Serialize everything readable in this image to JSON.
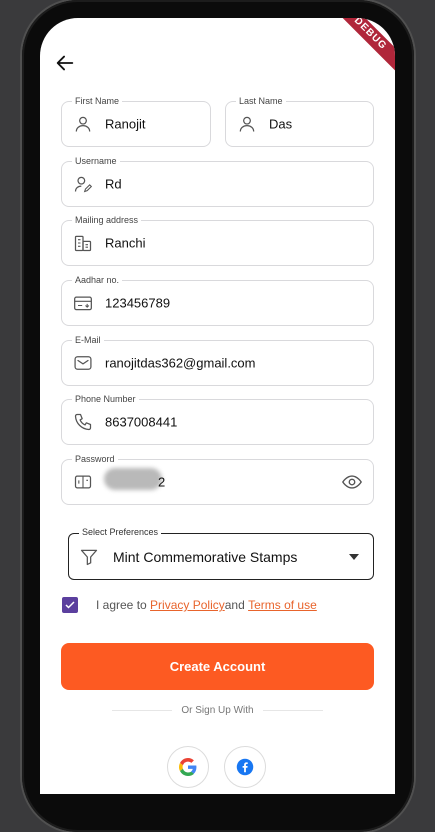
{
  "debug_banner": "DEBUG",
  "fields": {
    "first_name": {
      "label": "First Name",
      "value": "Ranojit"
    },
    "last_name": {
      "label": "Last Name",
      "value": "Das"
    },
    "username": {
      "label": "Username",
      "value": "Rd"
    },
    "mailing_address": {
      "label": "Mailing address",
      "value": "Ranchi"
    },
    "aadhar": {
      "label": "Aadhar no.",
      "value": "123456789"
    },
    "email": {
      "label": "E-Mail",
      "value": "ranojitdas362@gmail.com"
    },
    "phone": {
      "label": "Phone Number",
      "value": "8637008441"
    },
    "password": {
      "label": "Password",
      "visible_tail": "2"
    }
  },
  "preferences": {
    "label": "Select Preferences",
    "value": "Mint Commemorative Stamps"
  },
  "agreement": {
    "checked": true,
    "prefix": "I agree to ",
    "privacy": "Privacy Policy",
    "and": "and ",
    "terms": "Terms of use"
  },
  "create_button": "Create Account",
  "or_text": "Or Sign Up With",
  "social": {
    "google": "google-icon",
    "facebook": "facebook-icon"
  },
  "colors": {
    "accent": "#fd5a22",
    "checkbox": "#5b3f9e",
    "link": "#e8642c"
  }
}
